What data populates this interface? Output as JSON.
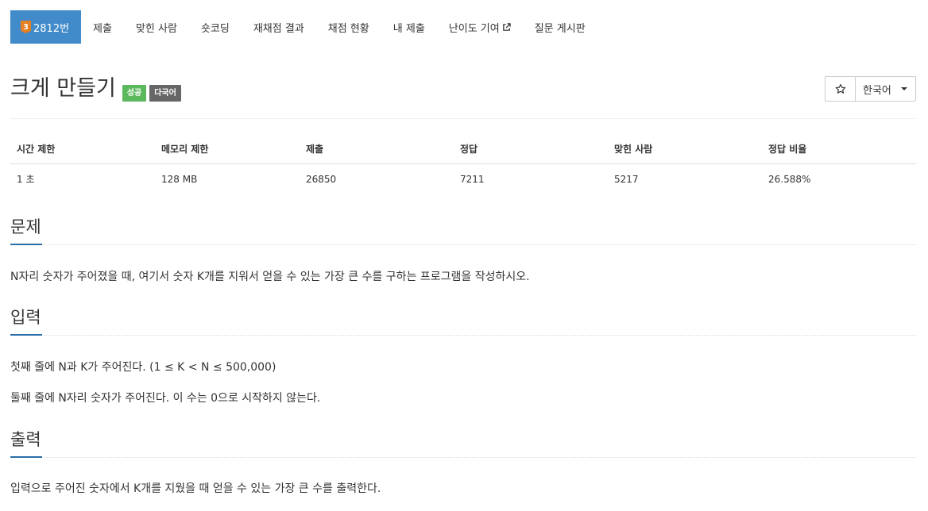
{
  "nav": {
    "tabs": [
      {
        "label": "2812번",
        "badge": "3"
      },
      {
        "label": "제출"
      },
      {
        "label": "맞힌 사람"
      },
      {
        "label": "숏코딩"
      },
      {
        "label": "재채점 결과"
      },
      {
        "label": "채점 현황"
      },
      {
        "label": "내 제출"
      },
      {
        "label": "난이도 기여"
      },
      {
        "label": "질문 게시판"
      }
    ],
    "tier_color": "#e67e22",
    "active_color": "#428bca"
  },
  "problem": {
    "title": "크게 만들기",
    "labels": [
      "성공",
      "다국어"
    ],
    "language": "한국어",
    "star_icon": "star-outline-icon"
  },
  "info": {
    "headers": [
      "시간 제한",
      "메모리 제한",
      "제출",
      "정답",
      "맞힌 사람",
      "정답 비율"
    ],
    "values": [
      "1 초",
      "128 MB",
      "26850",
      "7211",
      "5217",
      "26.588%"
    ]
  },
  "sections": {
    "problem": {
      "title": "문제",
      "paragraphs": [
        "N자리 숫자가 주어졌을 때, 여기서 숫자 K개를 지워서 얻을 수 있는 가장 큰 수를 구하는 프로그램을 작성하시오."
      ]
    },
    "input": {
      "title": "입력",
      "paragraphs": [
        "첫째 줄에 N과 K가 주어진다. (1 ≤ K < N ≤ 500,000)",
        "둘째 줄에 N자리 숫자가 주어진다. 이 수는 0으로 시작하지 않는다."
      ]
    },
    "output": {
      "title": "출력",
      "paragraphs": [
        "입력으로 주어진 숫자에서 K개를 지웠을 때 얻을 수 있는 가장 큰 수를 출력한다."
      ]
    }
  }
}
